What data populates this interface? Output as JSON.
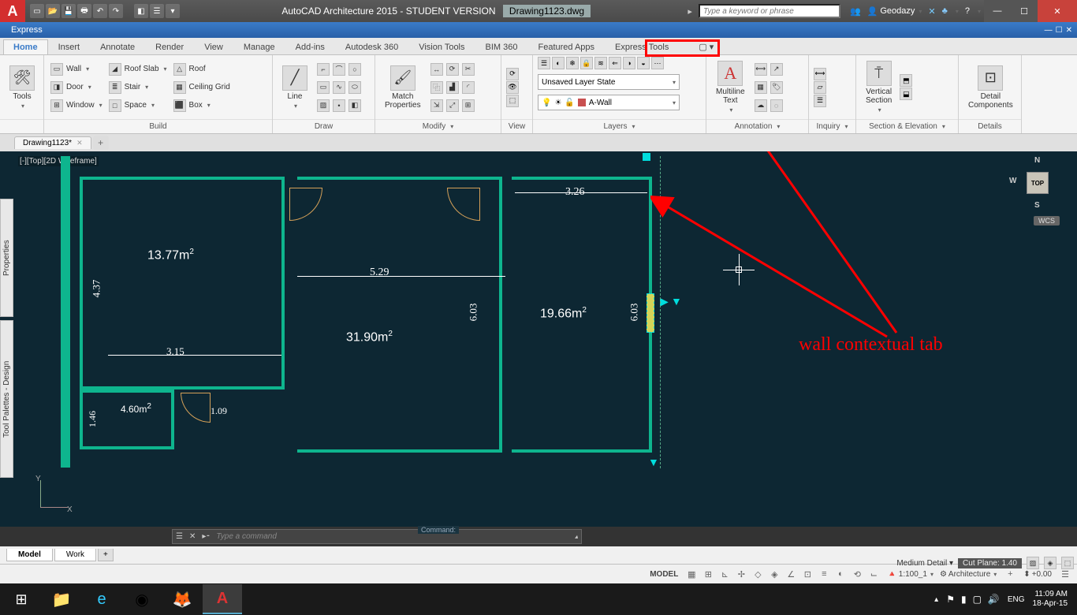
{
  "titlebar": {
    "app_title": "AutoCAD Architecture 2015 - STUDENT VERSION",
    "doc": "Drawing1123.dwg",
    "search_placeholder": "Type a keyword or phrase",
    "username": "Geodazy"
  },
  "express": "Express",
  "tabs": [
    "Home",
    "Insert",
    "Annotate",
    "Render",
    "View",
    "Manage",
    "Add-ins",
    "Autodesk 360",
    "Vision Tools",
    "BIM 360",
    "Featured Apps",
    "Express Tools"
  ],
  "ribbon": {
    "tools": "Tools",
    "build": {
      "label": "Build",
      "wall": "Wall",
      "door": "Door",
      "window": "Window",
      "roofslab": "Roof Slab",
      "stair": "Stair",
      "space": "Space",
      "roof": "Roof",
      "ceilinggrid": "Ceiling Grid",
      "box": "Box"
    },
    "draw": {
      "label": "Draw",
      "line": "Line"
    },
    "modify": {
      "label": "Modify",
      "match": "Match\nProperties"
    },
    "view": {
      "label": "View"
    },
    "layers": {
      "label": "Layers",
      "state": "Unsaved Layer State",
      "current": "A-Wall"
    },
    "annotation": {
      "label": "Annotation",
      "mtext": "Multiline\nText"
    },
    "inquiry": {
      "label": "Inquiry"
    },
    "section": {
      "label": "Section & Elevation",
      "vsection": "Vertical\nSection"
    },
    "details": {
      "label": "Details",
      "detail": "Detail\nComponents"
    }
  },
  "doc_tab": "Drawing1123*",
  "viewport_label": "[-][Top][2D Wireframe]",
  "viewcube": {
    "top": "TOP",
    "n": "N",
    "s": "S",
    "w": "W",
    "wcs": "WCS"
  },
  "palettes": {
    "props": "Properties",
    "tool": "Tool Palettes - Design"
  },
  "dims": {
    "a1": "13.77m",
    "a2": "31.90m",
    "a3": "19.66m",
    "a4": "4.60m",
    "d1": "3.26",
    "d2": "5.29",
    "d3": "6.03",
    "d4": "6.03",
    "d5": "3.15",
    "d6": "4.37",
    "d7": "1.09",
    "d8": "1.46"
  },
  "cmdline": {
    "placeholder": "Type a command",
    "label": "Command:"
  },
  "bottom_tabs": [
    "Model",
    "Work"
  ],
  "bottom_info": {
    "detail": "Medium Detail",
    "cutplane_label": "Cut Plane:",
    "cutplane_val": "1.40"
  },
  "statusbar": {
    "model": "MODEL",
    "scale": "1:100_1",
    "style": "Architecture",
    "elev": "+0.00"
  },
  "taskbar": {
    "lang": "ENG",
    "time": "11:09 AM",
    "date": "18-Apr-15"
  },
  "annotation_text": "wall contextual tab",
  "ucs": {
    "x": "X",
    "y": "Y"
  }
}
